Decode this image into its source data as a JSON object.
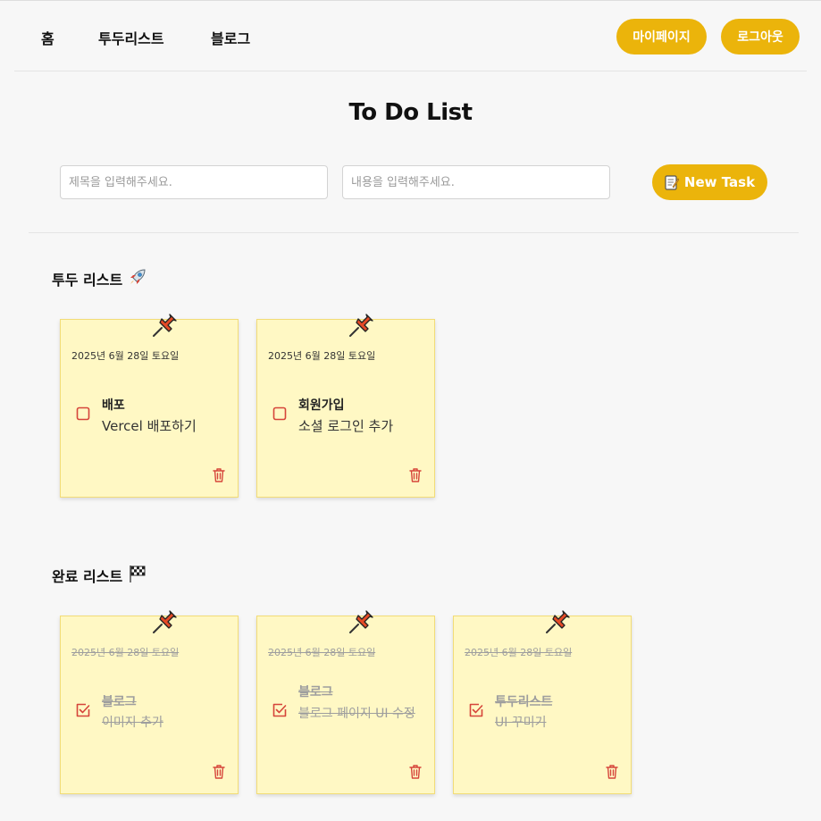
{
  "nav": {
    "home": "홈",
    "todolist": "투두리스트",
    "blog": "블로그",
    "mypage": "마이페이지",
    "logout": "로그아웃"
  },
  "page_title": "To Do List",
  "form": {
    "title_placeholder": "제목을 입력해주세요.",
    "content_placeholder": "내용을 입력해주세요.",
    "new_task_label": "New Task",
    "new_task_icon": "memo-icon"
  },
  "todo_section": {
    "title": "투두 리스트",
    "icon": "rocket-icon",
    "cards": [
      {
        "date": "2025년 6월 28일 토요일",
        "title": "배포",
        "body": "Vercel 배포하기",
        "done": false
      },
      {
        "date": "2025년 6월 28일 토요일",
        "title": "회원가입",
        "body": "소셜 로그인 추가",
        "done": false
      }
    ]
  },
  "done_section": {
    "title": "완료 리스트",
    "icon": "checkered-flag-icon",
    "cards": [
      {
        "date": "2025년 6월 28일 토요일",
        "title": "블로그",
        "body": "이미지 추가",
        "done": true
      },
      {
        "date": "2025년 6월 28일 토요일",
        "title": "블로그",
        "body": "블로그 페이지 UI 수정",
        "done": true
      },
      {
        "date": "2025년 6월 28일 토요일",
        "title": "투두리스트",
        "body": "UI 꾸미기",
        "done": true
      }
    ]
  },
  "colors": {
    "accent": "#ebb40b",
    "card_bg": "#fff8c4",
    "card_border": "#f2dc77",
    "check_red": "#d6453a",
    "page_bg": "#f7f7f7"
  }
}
